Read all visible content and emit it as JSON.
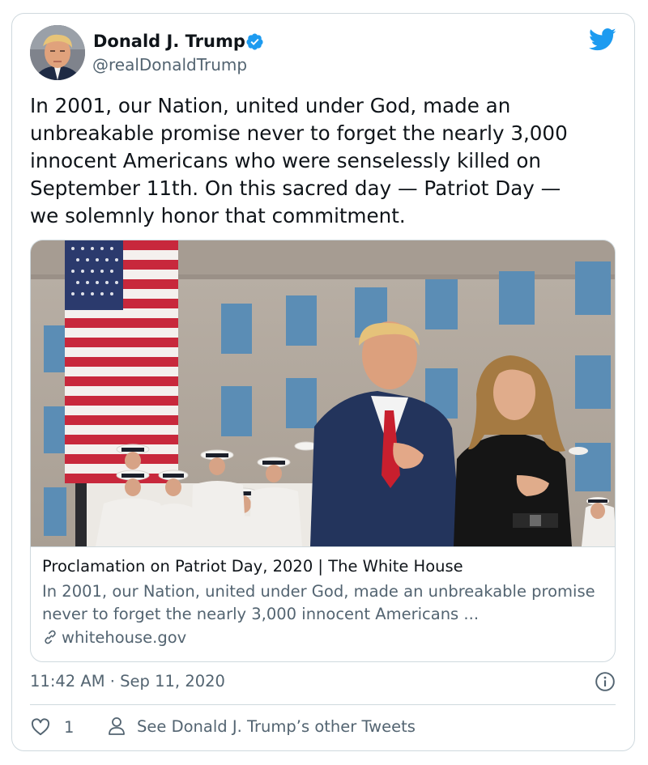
{
  "author": {
    "display_name": "Donald J. Trump",
    "handle": "@realDonaldTrump",
    "verified": true
  },
  "tweet": {
    "text": "In 2001, our Nation, united under God, made an\nunbreakable promise never to forget the nearly 3,000\ninnocent Americans who were senselessly killed on\nSeptember 11th. On this sacred day — Patriot Day —\nwe solemnly honor that commitment.",
    "timestamp": "11:42 AM · Sep 11, 2020"
  },
  "link_card": {
    "title": "Proclamation on Patriot Day, 2020 | The White House",
    "description": "In 2001, our Nation, united under God, made an unbreakable promise never to forget the nearly 3,000 innocent Americans ...",
    "domain": "whitehouse.gov"
  },
  "actions": {
    "like_count": "1",
    "other_tweets_label": "See Donald J. Trump’s other Tweets"
  },
  "colors": {
    "brand_blue": "#1d9bf0",
    "text_primary": "#0f1419",
    "text_secondary": "#536471",
    "border": "#cfd9de"
  },
  "icons": [
    "twitter-bird-icon",
    "verified-badge-icon",
    "link-icon",
    "info-icon",
    "heart-icon",
    "person-icon"
  ]
}
